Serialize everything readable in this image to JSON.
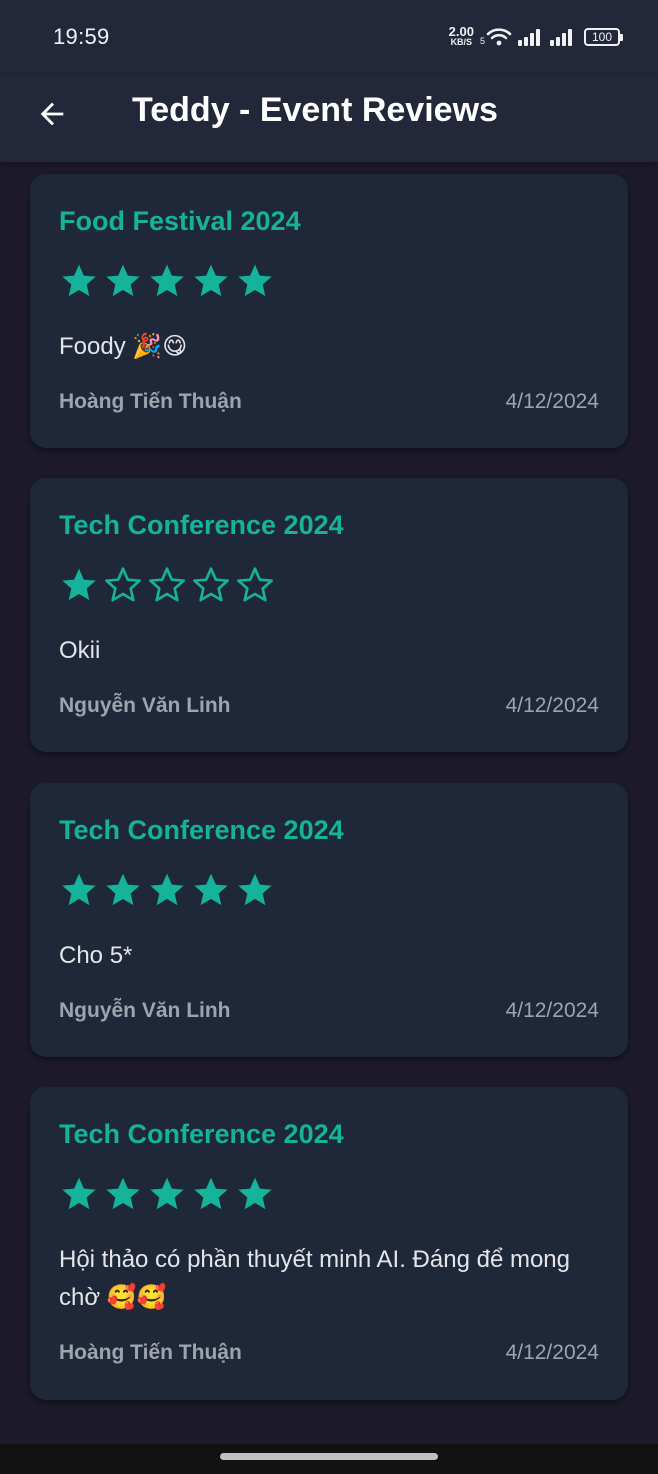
{
  "status": {
    "time": "19:59",
    "net_speed_value": "2.00",
    "net_speed_unit": "KB/S",
    "wifi_badge": "5",
    "battery": "100"
  },
  "appbar": {
    "title": "Teddy - Event Reviews",
    "back_icon": "arrow-left-icon"
  },
  "colors": {
    "accent": "#14b39a",
    "card_bg": "#1f2838",
    "page_bg": "#1d1b2b",
    "appbar_bg": "#222839",
    "muted_text": "#9ea3ad"
  },
  "reviews": [
    {
      "event": "Food Festival 2024",
      "rating": 5,
      "max_rating": 5,
      "comment": "Foody 🎉😋",
      "author": "Hoàng Tiến Thuận",
      "date": "4/12/2024"
    },
    {
      "event": "Tech Conference 2024",
      "rating": 1,
      "max_rating": 5,
      "comment": "Okii",
      "author": "Nguyễn Văn Linh",
      "date": "4/12/2024"
    },
    {
      "event": "Tech Conference 2024",
      "rating": 5,
      "max_rating": 5,
      "comment": "Cho 5*",
      "author": "Nguyễn Văn Linh",
      "date": "4/12/2024"
    },
    {
      "event": "Tech Conference 2024",
      "rating": 5,
      "max_rating": 5,
      "comment": "Hội thảo có phần thuyết minh AI. Đáng để mong chờ 🥰🥰",
      "author": "Hoàng Tiến Thuận",
      "date": "4/12/2024"
    }
  ]
}
